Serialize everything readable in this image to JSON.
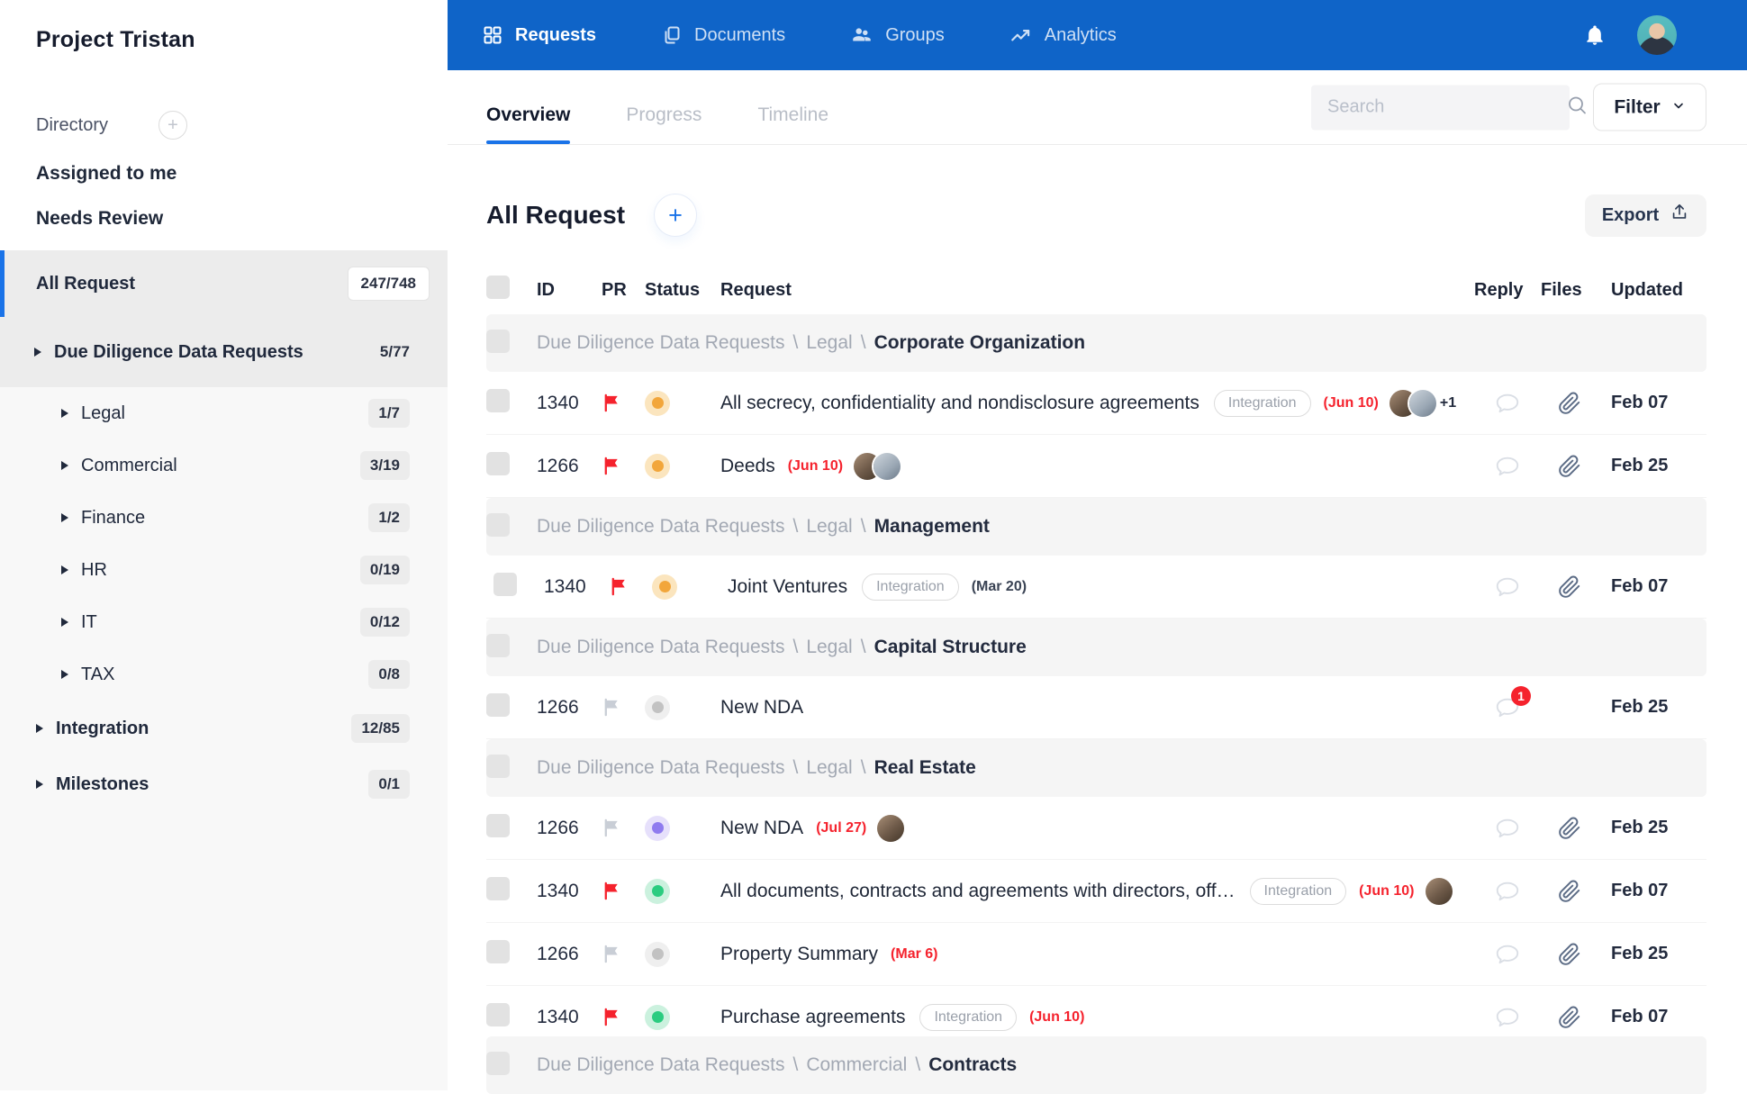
{
  "theme": {
    "nav_blue": "#0F64C8",
    "accent_blue": "#1A73E8",
    "alert_red": "#F5222D",
    "status_orange": "#F2A63B",
    "status_green": "#2BCC80",
    "status_purple": "#8F7BEF",
    "status_gray": "#C2C2C2"
  },
  "sidebar": {
    "title": "Project Tristan",
    "directory_label": "Directory",
    "links": [
      {
        "label": "Assigned to me"
      },
      {
        "label": "Needs Review"
      }
    ],
    "tree": [
      {
        "label": "All Request",
        "count": "247/748",
        "level": 0,
        "active": true,
        "arrow": false
      },
      {
        "label": "Due Diligence Data Requests",
        "count": "5/77",
        "level": 1,
        "arrow": true,
        "bare_count": true
      },
      {
        "label": "Legal",
        "count": "1/7",
        "level": 2,
        "arrow": true
      },
      {
        "label": "Commercial",
        "count": "3/19",
        "level": 2,
        "arrow": true
      },
      {
        "label": "Finance",
        "count": "1/2",
        "level": 2,
        "arrow": true
      },
      {
        "label": "HR",
        "count": "0/19",
        "level": 2,
        "arrow": true
      },
      {
        "label": "IT",
        "count": "0/12",
        "level": 2,
        "arrow": true
      },
      {
        "label": "TAX",
        "count": "0/8",
        "level": 2,
        "arrow": true
      },
      {
        "label": "Integration",
        "count": "12/85",
        "level": 1,
        "plain": true,
        "arrow": true
      },
      {
        "label": "Milestones",
        "count": "0/1",
        "level": 1,
        "plain": true,
        "arrow": true
      }
    ]
  },
  "nav": {
    "items": [
      {
        "label": "Requests",
        "icon": "grid-icon",
        "active": true
      },
      {
        "label": "Documents",
        "icon": "documents-icon",
        "active": false
      },
      {
        "label": "Groups",
        "icon": "people-icon",
        "active": false
      },
      {
        "label": "Analytics",
        "icon": "trend-icon",
        "active": false
      }
    ]
  },
  "tabs": [
    {
      "label": "Overview",
      "active": true
    },
    {
      "label": "Progress",
      "active": false
    },
    {
      "label": "Timeline",
      "active": false
    }
  ],
  "search": {
    "placeholder": "Search"
  },
  "filter": {
    "label": "Filter"
  },
  "page": {
    "title": "All Request",
    "export_label": "Export"
  },
  "table": {
    "columns": {
      "id": "ID",
      "pr": "PR",
      "status": "Status",
      "request": "Request",
      "reply": "Reply",
      "files": "Files",
      "updated": "Updated"
    },
    "rows": [
      {
        "type": "group",
        "path": [
          "Due Diligence Data Requests",
          "Legal"
        ],
        "leaf": "Corporate Organization"
      },
      {
        "type": "item",
        "id": "1340",
        "flag": "red",
        "status": "orange",
        "title": "All secrecy, confidentiality and nondisclosure agreements",
        "badge": "Integration",
        "due": "(Jun 10)",
        "avatars": 2,
        "overflow": "+1",
        "has_file": true,
        "updated": "Feb 07"
      },
      {
        "type": "item",
        "id": "1266",
        "flag": "red",
        "status": "orange",
        "title": "Deeds",
        "due": "(Jun 10)",
        "avatars": 2,
        "has_file": true,
        "updated": "Feb 25"
      },
      {
        "type": "group",
        "path": [
          "Due Diligence Data Requests",
          "Legal"
        ],
        "leaf": "Management"
      },
      {
        "type": "item",
        "id": "1340",
        "flag": "red",
        "status": "orange",
        "indent": true,
        "title": "Joint Ventures",
        "badge": "Integration",
        "due": "(Mar 20)",
        "due_muted": true,
        "has_file": true,
        "updated": "Feb 07"
      },
      {
        "type": "group",
        "path": [
          "Due Diligence Data Requests",
          "Legal"
        ],
        "leaf": "Capital Structure"
      },
      {
        "type": "item",
        "id": "1266",
        "flag": "gray",
        "status": "gray",
        "title": "New NDA",
        "reply_count": "1",
        "has_file": false,
        "updated": "Feb 25"
      },
      {
        "type": "group",
        "path": [
          "Due Diligence Data Requests",
          "Legal"
        ],
        "leaf": "Real Estate"
      },
      {
        "type": "item",
        "id": "1266",
        "flag": "gray",
        "status": "purple",
        "title": "New NDA",
        "due": "(Jul 27)",
        "avatars": 1,
        "has_file": true,
        "updated": "Feb 25"
      },
      {
        "type": "item",
        "id": "1340",
        "flag": "red",
        "status": "green",
        "title": "All documents, contracts and agreements with directors, off…",
        "badge": "Integration",
        "due": "(Jun 10)",
        "avatars": 1,
        "has_file": true,
        "updated": "Feb 07"
      },
      {
        "type": "item",
        "id": "1266",
        "flag": "gray",
        "status": "gray",
        "title": "Property Summary",
        "due": "(Mar 6)",
        "has_file": true,
        "updated": "Feb 25"
      },
      {
        "type": "item",
        "id": "1340",
        "flag": "red",
        "status": "green",
        "title": "Purchase agreements",
        "badge": "Integration",
        "due": "(Jun 10)",
        "has_file": true,
        "updated": "Feb 07"
      },
      {
        "type": "group",
        "path": [
          "Due Diligence Data Requests",
          "Commercial"
        ],
        "leaf": "Contracts",
        "clipped": true
      }
    ]
  }
}
